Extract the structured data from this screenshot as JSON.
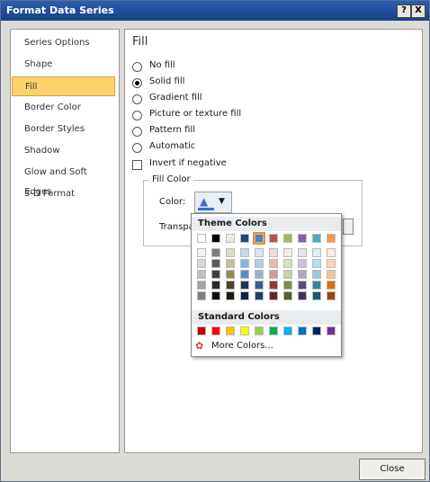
{
  "window": {
    "title": "Format Data Series",
    "help": "?",
    "close": "X"
  },
  "sidebar": {
    "items": [
      {
        "label": "Series Options"
      },
      {
        "label": "Shape"
      },
      {
        "label": "Fill"
      },
      {
        "label": "Border Color"
      },
      {
        "label": "Border Styles"
      },
      {
        "label": "Shadow"
      },
      {
        "label": "Glow and Soft Edges"
      },
      {
        "label": "3-D Format"
      }
    ],
    "selected": "Fill"
  },
  "main": {
    "title": "Fill",
    "options": [
      {
        "label": "No fill",
        "checked": false
      },
      {
        "label": "Solid fill",
        "checked": true
      },
      {
        "label": "Gradient fill",
        "checked": false
      },
      {
        "label": "Picture or texture fill",
        "checked": false
      },
      {
        "label": "Pattern fill",
        "checked": false
      },
      {
        "label": "Automatic",
        "checked": false
      }
    ],
    "invert_label": "Invert if negative",
    "group_title": "Fill Color",
    "color_label": "Color:",
    "transparency_label": "Transpa"
  },
  "popup": {
    "theme_heading": "Theme Colors",
    "standard_heading": "Standard Colors",
    "more_label": "More Colors...",
    "theme_top": [
      "#ffffff",
      "#000000",
      "#eeece1",
      "#1f497d",
      "#4f81bd",
      "#c0504d",
      "#9bbb59",
      "#8064a2",
      "#4bacc6",
      "#f79646"
    ],
    "theme_shades": [
      [
        "#f2f2f2",
        "#d8d8d8",
        "#bfbfbf",
        "#a5a5a5",
        "#7f7f7f"
      ],
      [
        "#7f7f7f",
        "#595959",
        "#3f3f3f",
        "#262626",
        "#0c0c0c"
      ],
      [
        "#ddd9c3",
        "#c4bd97",
        "#938953",
        "#494429",
        "#1d1b10"
      ],
      [
        "#c6d9f0",
        "#8db3e2",
        "#548dd4",
        "#17365d",
        "#0f243e"
      ],
      [
        "#dbe5f1",
        "#b8cce4",
        "#95b3d7",
        "#366092",
        "#244061"
      ],
      [
        "#f2dcdb",
        "#e5b9b7",
        "#d99694",
        "#953734",
        "#632423"
      ],
      [
        "#ebf1dd",
        "#d7e3bc",
        "#c3d69b",
        "#76923c",
        "#4f6128"
      ],
      [
        "#e5e0ec",
        "#ccc1d9",
        "#b2a2c7",
        "#5f497a",
        "#3f3151"
      ],
      [
        "#dbeef3",
        "#b7dde8",
        "#92cddc",
        "#31859b",
        "#205867"
      ],
      [
        "#fdeada",
        "#fbd5b5",
        "#fac08f",
        "#e36c09",
        "#974806"
      ]
    ],
    "standard": [
      "#c00000",
      "#ff0000",
      "#ffc000",
      "#ffff00",
      "#92d050",
      "#00b050",
      "#00b0f0",
      "#0070c0",
      "#002060",
      "#7030a0"
    ],
    "selected_index": 4
  },
  "footer": {
    "close_label": "Close"
  }
}
